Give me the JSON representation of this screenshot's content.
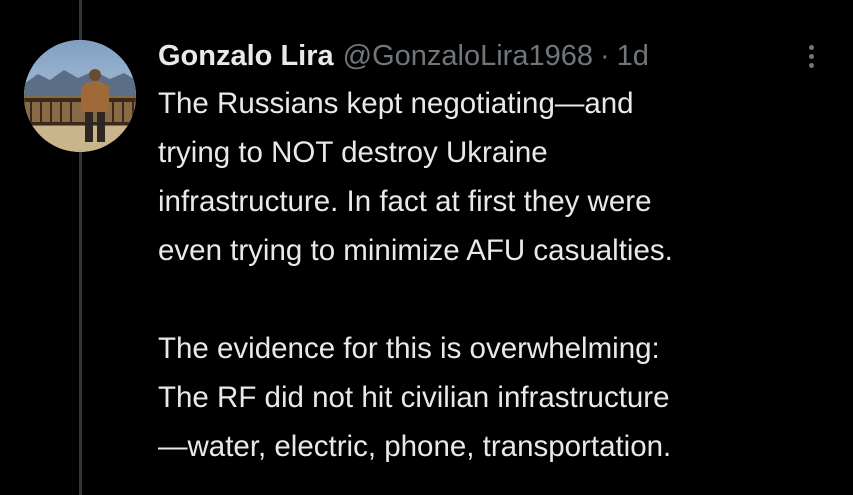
{
  "tweet": {
    "author": {
      "display_name": "Gonzalo Lira",
      "handle": "@GonzaloLira1968",
      "avatar_icon": "profile-photo"
    },
    "separator": "·",
    "time": "1d",
    "more_icon": "more-options-icon",
    "paragraphs": [
      "The Russians kept negotiating—and\ntrying to NOT destroy Ukraine\ninfrastructure. In fact at first they were\neven trying to minimize AFU casualties.",
      "The evidence for this is overwhelming:\nThe RF did not hit civilian infrastructure\n—water, electric, phone, transportation."
    ]
  },
  "colors": {
    "background": "#000000",
    "text": "#e7e9ea",
    "secondary": "#71767b",
    "thread_line": "#333639"
  }
}
